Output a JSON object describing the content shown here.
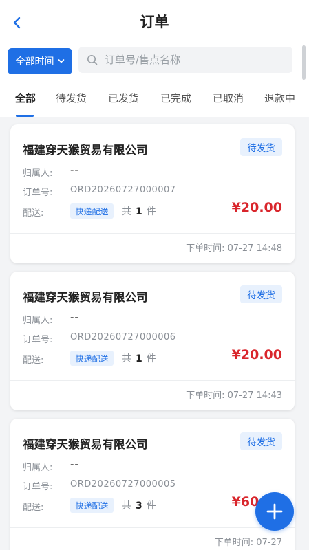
{
  "header": {
    "title": "订单",
    "back_icon": "chevron-left-icon"
  },
  "filter": {
    "time_label": "全部时间",
    "search_placeholder": "订单号/售点名称",
    "search_value": ""
  },
  "tabs": [
    {
      "label": "全部",
      "active": true
    },
    {
      "label": "待发货",
      "active": false
    },
    {
      "label": "已发货",
      "active": false
    },
    {
      "label": "已完成",
      "active": false
    },
    {
      "label": "已取消",
      "active": false
    },
    {
      "label": "退款中",
      "active": false
    }
  ],
  "labels": {
    "owner": "归属人:",
    "order_no": "订单号:",
    "shipping": "配送:",
    "total_prefix": "共",
    "unit": "件",
    "time_prefix": "下单时间:"
  },
  "orders": [
    {
      "company": "福建穿天猴贸易有限公司",
      "status": "待发货",
      "owner": "--",
      "order_no": "ORD20260727000007",
      "shipping": "快递配送",
      "qty": "1",
      "price": "¥20.00",
      "time": "07-27 14:48"
    },
    {
      "company": "福建穿天猴贸易有限公司",
      "status": "待发货",
      "owner": "--",
      "order_no": "ORD20260727000006",
      "shipping": "快递配送",
      "qty": "1",
      "price": "¥20.00",
      "time": "07-27 14:43"
    },
    {
      "company": "福建穿天猴贸易有限公司",
      "status": "待发货",
      "owner": "--",
      "order_no": "ORD20260727000005",
      "shipping": "快递配送",
      "qty": "3",
      "price": "¥60.00",
      "time": "07-27"
    }
  ],
  "colors": {
    "accent": "#1f6fe5",
    "price": "#d9262c",
    "badge_bg": "#e8f1fd"
  }
}
